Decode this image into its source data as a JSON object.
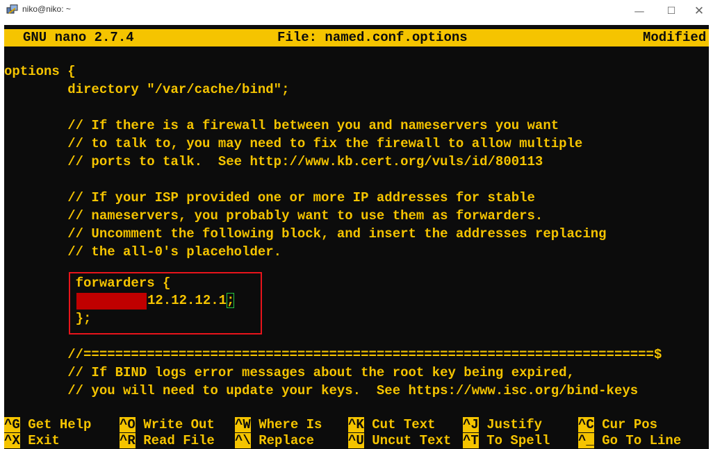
{
  "window": {
    "title": "niko@niko: ~",
    "minimize_glyph": "—",
    "maximize_glyph": "☐",
    "close_glyph": "✕",
    "icon": "putty-terminal-icon"
  },
  "nano": {
    "version": "GNU nano 2.7.4",
    "file_label": "File: named.conf.options",
    "status": "Modified"
  },
  "editor": {
    "lines": [
      "options {",
      "        directory \"/var/cache/bind\";",
      "",
      "        // If there is a firewall between you and nameservers you want",
      "        // to talk to, you may need to fix the firewall to allow multiple",
      "        // ports to talk.  See http://www.kb.cert.org/vuls/id/800113",
      "",
      "        // If your ISP provided one or more IP addresses for stable",
      "        // nameservers, you probably want to use them as forwarders.",
      "        // Uncomment the following block, and insert the addresses replacing",
      "        // the all-0's placeholder.",
      "",
      "         forwarders {",
      "",
      "         };",
      "",
      "        //========================================================================$",
      "        // If BIND logs error messages about the root key being expired,",
      "        // you will need to update your keys.  See https://www.isc.org/bind-keys"
    ],
    "forwarder_ip": "12.12.12.1",
    "cursor_char": ";"
  },
  "shortcuts": {
    "row1": [
      {
        "key": "^G",
        "label": " Get Help"
      },
      {
        "key": "^O",
        "label": " Write Out"
      },
      {
        "key": "^W",
        "label": " Where Is"
      },
      {
        "key": "^K",
        "label": " Cut Text"
      },
      {
        "key": "^J",
        "label": " Justify"
      },
      {
        "key": "^C",
        "label": " Cur Pos"
      }
    ],
    "row2": [
      {
        "key": "^X",
        "label": " Exit"
      },
      {
        "key": "^R",
        "label": " Read File"
      },
      {
        "key": "^\\",
        "label": " Replace"
      },
      {
        "key": "^U",
        "label": " Uncut Text"
      },
      {
        "key": "^T",
        "label": " To Spell"
      },
      {
        "key": "^_",
        "label": " Go To Line"
      }
    ]
  },
  "colors": {
    "terminal_bg": "#0c0c0c",
    "nano_yellow": "#f5c400",
    "annotation_red": "#e8141b",
    "cursor_green": "#27c93f"
  }
}
